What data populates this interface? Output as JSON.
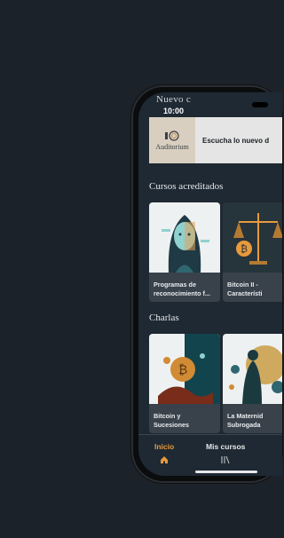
{
  "status": {
    "time": "10:00"
  },
  "header": {
    "title": "Nuevo c"
  },
  "auditorium": {
    "logo_text": "Auditorium",
    "tagline": "Escucha lo nuevo d"
  },
  "sections": {
    "accredited": {
      "title": "Cursos acreditados",
      "items": [
        {
          "label_line1": "Programas de",
          "label_line2": "reconocimiento f..."
        },
        {
          "label_line1": "Bitcoin II -",
          "label_line2": "Característi"
        }
      ]
    },
    "talks": {
      "title": "Charlas",
      "items": [
        {
          "label_line1": "Bitcoin y",
          "label_line2": "Sucesiones"
        },
        {
          "label_line1": "La Maternid",
          "label_line2": "Subrogada"
        }
      ]
    }
  },
  "tabbar": {
    "home_label": "Inicio",
    "courses_label": "Mis cursos",
    "home_icon": "home-icon",
    "courses_icon": "library-icon"
  },
  "colors": {
    "accent": "#e89a3c",
    "background": "#1f2933",
    "card": "#39424b"
  }
}
